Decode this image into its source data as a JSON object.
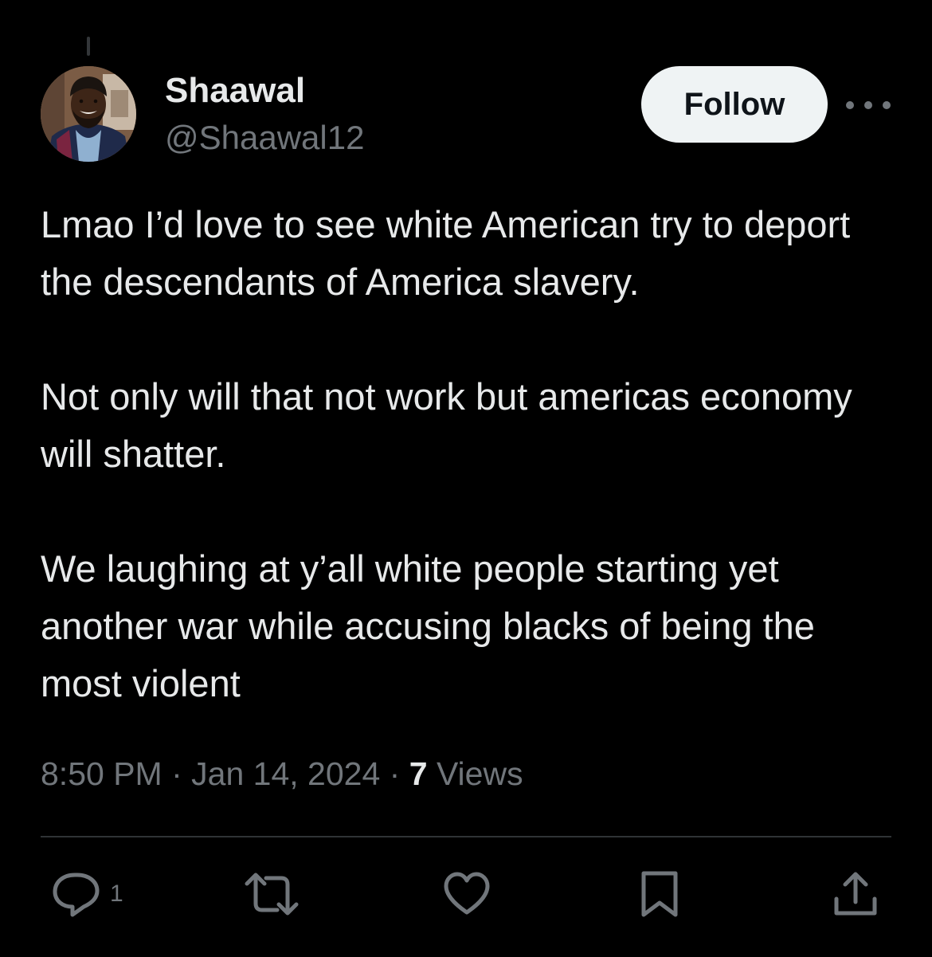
{
  "colors": {
    "background": "#000000",
    "text_primary": "#e7e9ea",
    "text_secondary": "#71767b",
    "follow_bg": "#eff3f4",
    "follow_text": "#0f1419",
    "divider": "#2f3336"
  },
  "author": {
    "display_name": "Shaawal",
    "handle": "@Shaawal12"
  },
  "header": {
    "follow_label": "Follow",
    "more_icon": "more-horizontal-icon"
  },
  "tweet": {
    "paragraphs": [
      "Lmao I’d love to see white American try to deport the descendants of America slavery.",
      "Not only will that not work but americas economy will shatter.",
      "We laughing at y’all white people starting yet another war while accusing blacks of being the most violent"
    ],
    "time": "8:50 PM",
    "separator": "·",
    "date": "Jan 14, 2024",
    "views_count": "7",
    "views_label": "Views"
  },
  "actions": {
    "reply": {
      "icon": "reply-icon",
      "count": "1"
    },
    "retweet": {
      "icon": "retweet-icon"
    },
    "like": {
      "icon": "like-icon"
    },
    "bookmark": {
      "icon": "bookmark-icon"
    },
    "share": {
      "icon": "share-icon"
    }
  }
}
